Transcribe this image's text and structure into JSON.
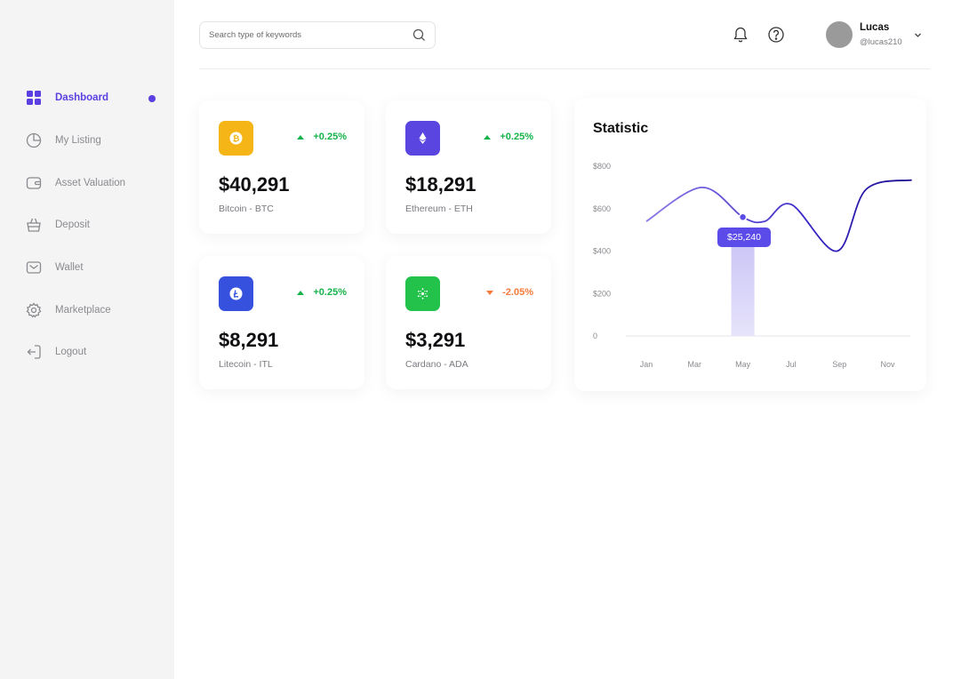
{
  "sidebar": {
    "items": [
      {
        "label": "Dashboard",
        "icon": "grid-icon",
        "active": true
      },
      {
        "label": "My Listing",
        "icon": "pie-chart-icon"
      },
      {
        "label": "Asset Valuation",
        "icon": "wallet-card-icon"
      },
      {
        "label": "Deposit",
        "icon": "basket-icon"
      },
      {
        "label": "Wallet",
        "icon": "envelope-icon"
      },
      {
        "label": "Marketplace",
        "icon": "gear-icon"
      },
      {
        "label": "Logout",
        "icon": "logout-icon"
      }
    ],
    "accent_color": "#5b3fe0"
  },
  "header": {
    "search_placeholder": "Search type of keywords",
    "user": {
      "name": "Lucas",
      "handle": "@lucas210"
    }
  },
  "coins": [
    {
      "price": "$40,291",
      "name": "Bitcoin - BTC",
      "change": "+0.25%",
      "direction": "up",
      "icon": "bitcoin-icon",
      "color": "#f5b517"
    },
    {
      "price": "$18,291",
      "name": "Ethereum - ETH",
      "change": "+0.25%",
      "direction": "up",
      "icon": "ethereum-icon",
      "color": "#5b45e0"
    },
    {
      "price": "$8,291",
      "name": "Litecoin - ITL",
      "change": "+0.25%",
      "direction": "up",
      "icon": "litecoin-icon",
      "color": "#3651de"
    },
    {
      "price": "$3,291",
      "name": "Cardano - ADA",
      "change": "-2.05%",
      "direction": "down",
      "icon": "cardano-icon",
      "color": "#22c24b"
    }
  ],
  "statistic": {
    "title": "Statistic",
    "tooltip": "$25,240"
  },
  "chart_data": {
    "type": "line",
    "title": "Statistic",
    "yticks": [
      "$800",
      "$600",
      "$400",
      "$200",
      "0"
    ],
    "ytick_values": [
      800,
      600,
      400,
      200,
      0
    ],
    "xticks": [
      "Jan",
      "Mar",
      "May",
      "Jul",
      "Sep",
      "Nov"
    ],
    "ylim": [
      0,
      800
    ],
    "grid": false,
    "series": [
      {
        "x": [
          0.0,
          1.15,
          2.0,
          2.45,
          3.0,
          3.95,
          4.55,
          5.5
        ],
        "y": [
          540,
          700,
          560,
          540,
          620,
          400,
          690,
          735
        ]
      }
    ],
    "highlight": {
      "x": "May",
      "label": "$25,240"
    }
  }
}
